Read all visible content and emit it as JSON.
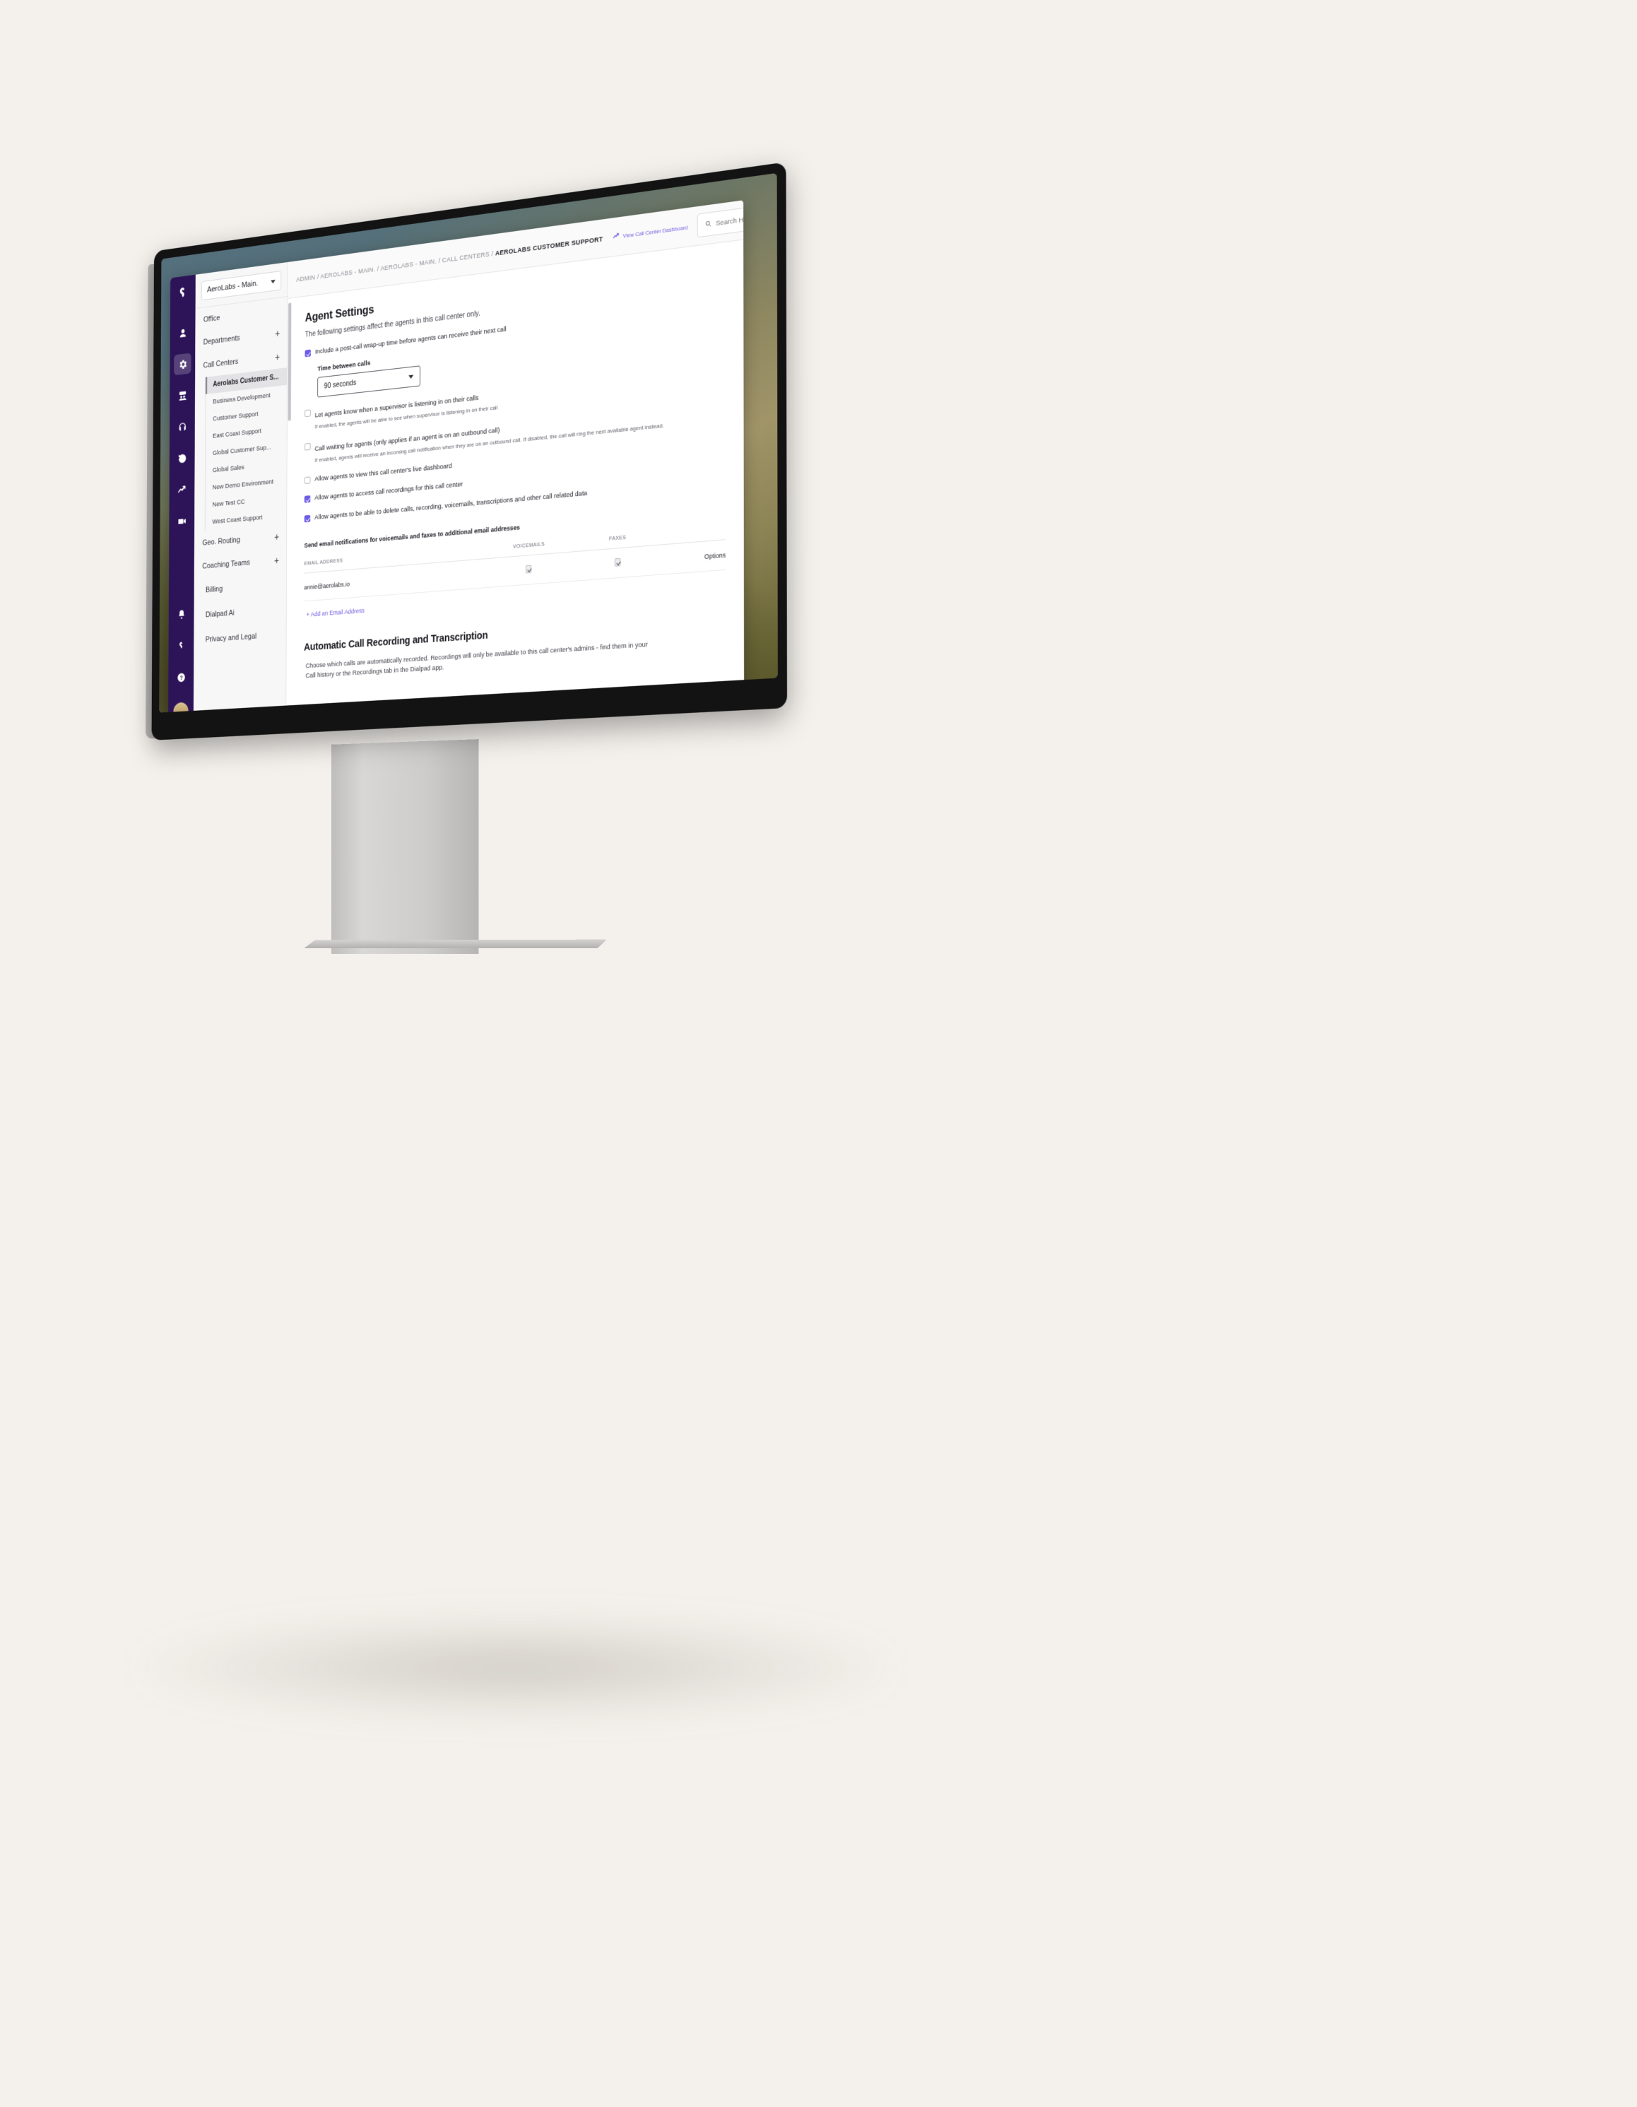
{
  "rail": {
    "logo_icon": "dialpad-logo-icon",
    "items": [
      {
        "icon": "person-icon",
        "name": "contacts",
        "active": false
      },
      {
        "icon": "gear-icon",
        "name": "settings",
        "active": true
      },
      {
        "icon": "meetings-icon",
        "name": "meetings",
        "active": false
      },
      {
        "icon": "headset-icon",
        "name": "contact-center",
        "active": false
      },
      {
        "icon": "history-icon",
        "name": "call-history",
        "active": false
      },
      {
        "icon": "analytics-icon",
        "name": "analytics",
        "active": false
      },
      {
        "icon": "video-icon",
        "name": "video",
        "active": false
      }
    ],
    "bottom": [
      {
        "icon": "bell-icon",
        "name": "notifications"
      },
      {
        "icon": "dialpad-icon",
        "name": "dialpad"
      },
      {
        "icon": "help-icon",
        "name": "help"
      }
    ],
    "avatar_label": "User avatar"
  },
  "sidebar": {
    "workspace": "AeroLabs - Main.",
    "office_label": "Office",
    "groups": [
      {
        "label": "Departments",
        "add": "+"
      },
      {
        "label": "Call Centers",
        "add": "+"
      }
    ],
    "call_centers": [
      "Aerolabs Customer S...",
      "Business Development",
      "Customer Support",
      "East Coast Support",
      "Global Customer Sup...",
      "Global Sales",
      "New Demo Environment",
      "New Test CC",
      "West Coast Support"
    ],
    "groups2": [
      {
        "label": "Geo. Routing",
        "add": "+"
      },
      {
        "label": "Coaching Teams",
        "add": "+"
      }
    ],
    "plain_items": [
      "Billing",
      "Dialpad Ai",
      "Privacy and Legal"
    ]
  },
  "topbar": {
    "breadcrumb_trail": "ADMIN / AEROLABS - MAIN. / AEROLABS - MAIN. / CALL CENTERS / ",
    "breadcrumb_current": "AEROLABS CUSTOMER SUPPORT",
    "dashboard_link": "View Call Center Dashboard",
    "dashboard_icon": "trending-up-icon",
    "search_icon": "search-icon",
    "search_placeholder": "Search Help Center",
    "search_value": ""
  },
  "agent_settings": {
    "title": "Agent Settings",
    "subtitle": "The following settings affect the agents in this call center only.",
    "checkboxes": [
      {
        "label": "Include a post-call wrap-up time before agents can receive their next call",
        "checked": true,
        "help": ""
      },
      {
        "label": "Let agents know when a supervisor is listening in on their calls",
        "checked": false,
        "help": "If enabled, the agents will be able to see when supervisor is listening in on their call"
      },
      {
        "label": "Call waiting for agents (only applies if an agent is on an outbound call)",
        "checked": false,
        "help": "If enabled, agents will receive an incoming call notification when they are on an outbound call. If disabled, the call will ring the next available agent instead."
      },
      {
        "label": "Allow agents to view this call center's live dashboard",
        "checked": false,
        "help": ""
      },
      {
        "label": "Allow agents to access call recordings for this call center",
        "checked": true,
        "help": ""
      },
      {
        "label": "Allow agents to be able to delete calls, recording, voicemails, transcriptions and other call related data",
        "checked": true,
        "help": ""
      }
    ],
    "time_between_calls_label": "Time between calls",
    "time_between_calls_value": "90 seconds"
  },
  "email_notifications": {
    "label": "Send email notifications for voicemails and faxes to additional email addresses",
    "columns": [
      "EMAIL ADDRESS",
      "VOICEMAILS",
      "FAXES",
      ""
    ],
    "rows": [
      {
        "email": "annie@aerolabs.io",
        "voicemails": true,
        "faxes": true,
        "options": "Options"
      }
    ],
    "add_link": "+ Add an Email Address"
  },
  "recording_section": {
    "title": "Automatic Call Recording and Transcription",
    "description": "Choose which calls are automatically recorded. Recordings will only be available to this call center's admins - find them in your Call history or the Recordings tab in the Dialpad app."
  },
  "colors": {
    "accent_purple": "#6c5ce7",
    "rail_purple": "#2d1458",
    "page_bg": "#f4f1ec"
  }
}
